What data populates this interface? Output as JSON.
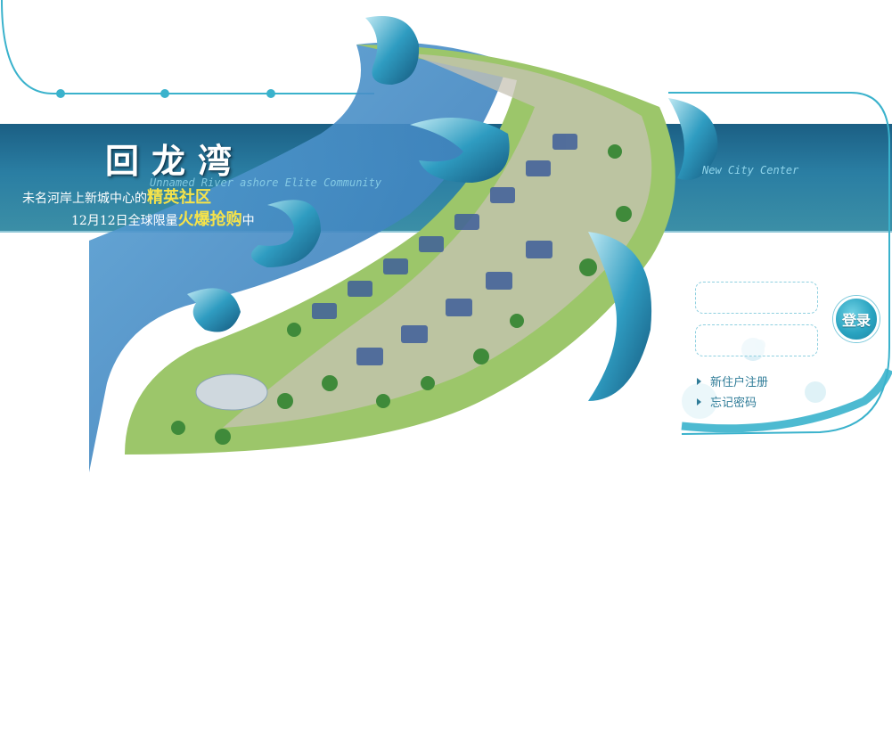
{
  "header": {
    "title": "回龙湾",
    "tagline1_prefix": "未名河岸上新城中心的",
    "tagline1_highlight": "精英社区",
    "tagline2_prefix": "12月12日全球限量",
    "tagline2_highlight": "火爆抢购",
    "tagline2_suffix": "中",
    "english_tag": "Unnamed River ashore Elite Community",
    "city_center": "New City Center"
  },
  "login": {
    "button_label": "登录",
    "username_value": "",
    "password_value": "",
    "register_link": "新住户注册",
    "forgot_link": "忘记密码"
  },
  "colors": {
    "banner": "#1b5f84",
    "accent": "#2aa4c1",
    "highlight": "#f6e34a"
  }
}
